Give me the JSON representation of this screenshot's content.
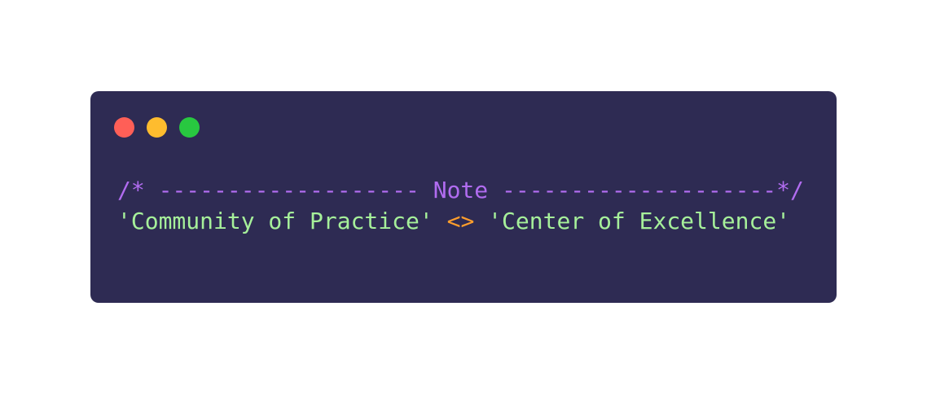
{
  "window": {
    "background": "#2e2b53",
    "controls": [
      {
        "name": "close",
        "color": "#ff5f57"
      },
      {
        "name": "minimize",
        "color": "#febc2e"
      },
      {
        "name": "maximize",
        "color": "#28c840"
      }
    ]
  },
  "code": {
    "comment_line": "/* ------------------- Note --------------------*/",
    "string_left": "'Community of Practice'",
    "operator": "<>",
    "string_right": "'Center of Excellence'"
  },
  "colors": {
    "comment": "#b16cf0",
    "string": "#a6f09a",
    "operator": "#ff9e2c"
  }
}
